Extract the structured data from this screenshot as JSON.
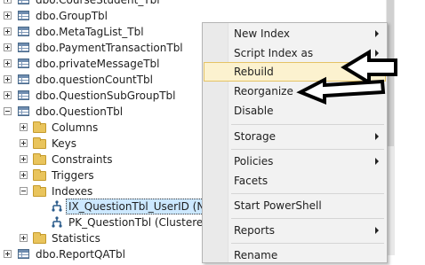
{
  "tree": {
    "items": [
      {
        "label": "dbo.CourseStudent_Tbl",
        "kind": "table",
        "expander": "plus"
      },
      {
        "label": "dbo.GroupTbl",
        "kind": "table",
        "expander": "plus"
      },
      {
        "label": "dbo.MetaTagList_Tbl",
        "kind": "table",
        "expander": "plus"
      },
      {
        "label": "dbo.PaymentTransactionTbl",
        "kind": "table",
        "expander": "plus"
      },
      {
        "label": "dbo.privateMessageTbl",
        "kind": "table",
        "expander": "plus"
      },
      {
        "label": "dbo.questionCountTbl",
        "kind": "table",
        "expander": "plus"
      },
      {
        "label": "dbo.QuestionSubGroupTbl",
        "kind": "table",
        "expander": "plus"
      },
      {
        "label": "dbo.QuestionTbl",
        "kind": "table",
        "expander": "minus"
      },
      {
        "label": "Columns",
        "kind": "folder",
        "expander": "plus"
      },
      {
        "label": "Keys",
        "kind": "folder",
        "expander": "plus"
      },
      {
        "label": "Constraints",
        "kind": "folder",
        "expander": "plus"
      },
      {
        "label": "Triggers",
        "kind": "folder",
        "expander": "plus"
      },
      {
        "label": "Indexes",
        "kind": "folder",
        "expander": "minus"
      },
      {
        "label": "IX_QuestionTbl_UserID (Non-Unique, Non-Clustered)",
        "kind": "index",
        "selected": true
      },
      {
        "label": "PK_QuestionTbl (Clustered)",
        "kind": "index"
      },
      {
        "label": "Statistics",
        "kind": "folder",
        "expander": "plus"
      },
      {
        "label": "dbo.ReportQATbl",
        "kind": "table",
        "expander": "plus"
      }
    ]
  },
  "context_menu": {
    "items": [
      {
        "label": "New Index",
        "submenu": true
      },
      {
        "label": "Script Index as",
        "submenu": true
      },
      {
        "label": "Rebuild",
        "highlighted": true
      },
      {
        "label": "Reorganize"
      },
      {
        "label": "Disable"
      },
      {
        "separator": true
      },
      {
        "label": "Storage",
        "submenu": true
      },
      {
        "separator": true
      },
      {
        "label": "Policies",
        "submenu": true
      },
      {
        "label": "Facets"
      },
      {
        "separator": true
      },
      {
        "label": "Start PowerShell"
      },
      {
        "separator": true
      },
      {
        "label": "Reports",
        "submenu": true
      },
      {
        "separator": true
      },
      {
        "label": "Rename"
      }
    ]
  },
  "colors": {
    "highlight_fill": "#fcf2cf",
    "highlight_border": "#e5c365",
    "selection_fill": "#cce8ff",
    "annotation_arrow": "#000000"
  }
}
